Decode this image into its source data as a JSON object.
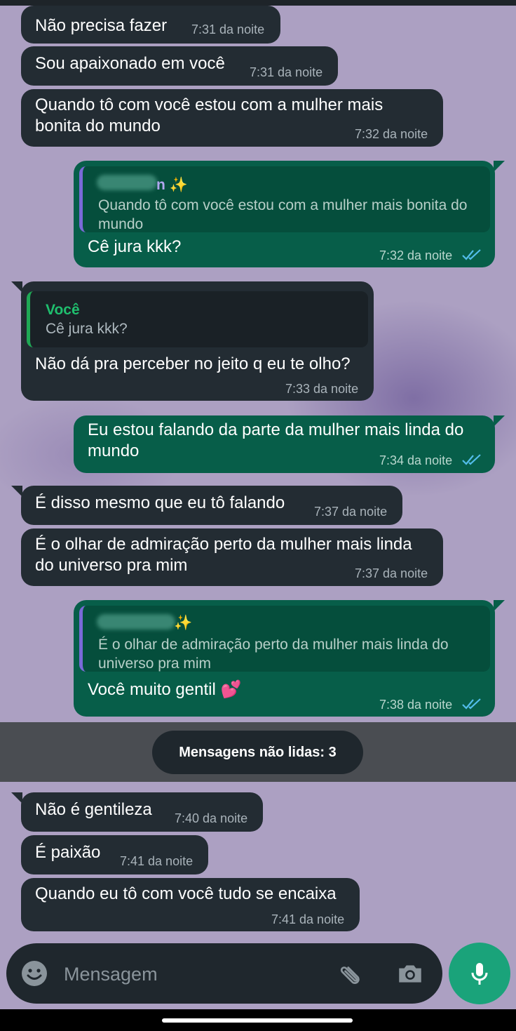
{
  "messages": [
    {
      "text": "Não precisa fazer",
      "time": "7:31 da noite"
    },
    {
      "text": "Sou apaixonado em você",
      "time": "7:31 da noite"
    },
    {
      "text": "Quando tô com você estou com a mulher mais bonita do mundo",
      "time": "7:32 da noite"
    },
    {
      "quote_name_suffix": "n ✨",
      "quote_text": "Quando tô com você estou com a mulher mais bonita do mundo",
      "text": "Cê jura kkk?",
      "time": "7:32 da noite"
    },
    {
      "quote_name": "Você",
      "quote_text": "Cê jura kkk?",
      "text": "Não dá pra perceber no jeito q eu te olho?",
      "time": "7:33 da noite"
    },
    {
      "text": "Eu estou falando da parte da mulher mais linda do mundo",
      "time": "7:34 da noite"
    },
    {
      "text": "É disso mesmo que eu tô falando",
      "time": "7:37 da noite"
    },
    {
      "text": "É o olhar de admiração perto da mulher mais linda do universo pra mim",
      "time": "7:37 da noite"
    },
    {
      "quote_name_suffix": "✨",
      "quote_text": "É o olhar de admiração perto da mulher mais linda do universo pra mim",
      "text": "Você muito gentil 💕",
      "time": "7:38 da noite"
    },
    {
      "text": "Não é gentileza",
      "time": "7:40 da noite"
    },
    {
      "text": "É paixão",
      "time": "7:41 da noite"
    },
    {
      "text": "Quando eu tô com você tudo se encaixa",
      "time": "7:41 da noite"
    }
  ],
  "unread_label": "Mensagens não lidas: 3",
  "composer": {
    "placeholder": "Mensagem"
  },
  "colors": {
    "incoming_bubble": "#232c33",
    "outgoing_bubble": "#075e49",
    "read_checks": "#53bdeb",
    "mic_button": "#1aa37a"
  },
  "icons": [
    "emoji-icon",
    "attach-icon",
    "camera-icon",
    "mic-icon",
    "double-check-icon"
  ]
}
